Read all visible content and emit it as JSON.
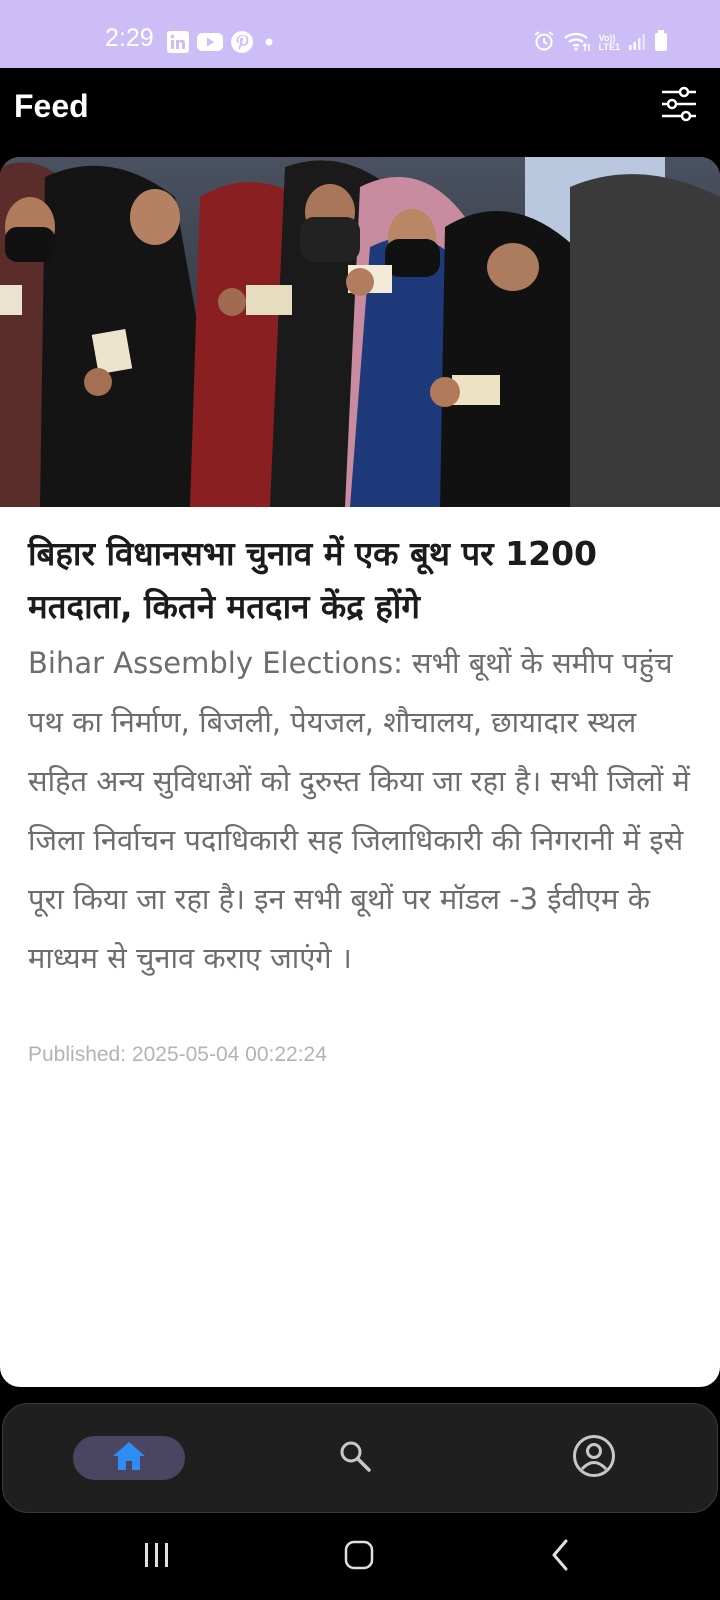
{
  "status_bar": {
    "time": "2:29",
    "left_icons": [
      "linkedin-icon",
      "youtube-icon",
      "pinterest-icon",
      "notification-dot-icon"
    ],
    "right_icons": [
      "alarm-icon",
      "wifi-icon",
      "volte-lte-icon",
      "signal-icon",
      "battery-icon"
    ],
    "network_label_top": "Vo))",
    "network_label_bottom": "LTE1",
    "background_color": "#cdbdf7"
  },
  "app_bar": {
    "title": "Feed",
    "filter_icon": "sliders-icon"
  },
  "article": {
    "image_icon": "news-photo",
    "headline": "बिहार विधानसभा चुनाव में एक बूथ पर 1200 मतदाता, कितने मतदान केंद्र होंगे",
    "summary": "Bihar Assembly Elections: सभी बूथों के समीप पहुंच पथ का निर्माण, बिजली, पेयजल, शौचालय, छायादार स्थल सहित अन्य सुविधाओं को दुरुस्त किया जा रहा है। सभी जिलों में जिला निर्वाचन पदाधिकारी सह जिलाधिकारी की निगरानी में इसे पूरा किया जा रहा है। इन सभी बूथों पर मॉडल -3 ईवीएम के माध्यम से चुनाव कराए जाएंगे ।",
    "published": "Published: 2025-05-04 00:22:24"
  },
  "bottom_nav": {
    "items": [
      {
        "icon": "home-icon",
        "active": true
      },
      {
        "icon": "search-icon",
        "active": false
      },
      {
        "icon": "profile-icon",
        "active": false
      }
    ],
    "active_color": "#2f8cf0"
  },
  "system_nav": {
    "buttons": [
      "recents-icon",
      "home-outline-icon",
      "back-icon"
    ]
  }
}
